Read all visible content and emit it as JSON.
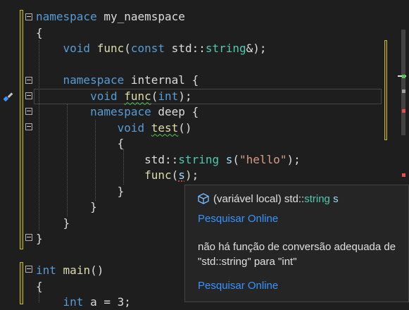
{
  "code_lines": [
    {
      "segments": [
        {
          "t": "namespace",
          "c": "kw"
        },
        {
          "t": " my_naemspace",
          "c": "ns"
        }
      ]
    },
    {
      "segments": [
        {
          "t": "{",
          "c": ""
        }
      ]
    },
    {
      "segments": [
        {
          "t": "    ",
          "c": ""
        },
        {
          "t": "void",
          "c": "kw"
        },
        {
          "t": " ",
          "c": ""
        },
        {
          "t": "func",
          "c": "fn"
        },
        {
          "t": "(",
          "c": ""
        },
        {
          "t": "const",
          "c": "kw"
        },
        {
          "t": " std::",
          "c": ""
        },
        {
          "t": "string",
          "c": "ty"
        },
        {
          "t": "&);",
          "c": ""
        }
      ]
    },
    {
      "segments": [
        {
          "t": "",
          "c": ""
        }
      ]
    },
    {
      "segments": [
        {
          "t": "    ",
          "c": ""
        },
        {
          "t": "namespace",
          "c": "kw"
        },
        {
          "t": " internal {",
          "c": "ns"
        }
      ]
    },
    {
      "segments": [
        {
          "t": "        ",
          "c": ""
        },
        {
          "t": "void",
          "c": "kw"
        },
        {
          "t": " ",
          "c": ""
        },
        {
          "t": "func",
          "c": "fn squig"
        },
        {
          "t": "(",
          "c": ""
        },
        {
          "t": "int",
          "c": "kw"
        },
        {
          "t": ");",
          "c": ""
        }
      ]
    },
    {
      "segments": [
        {
          "t": "        ",
          "c": ""
        },
        {
          "t": "namespace",
          "c": "kw"
        },
        {
          "t": " deep {",
          "c": "ns"
        }
      ]
    },
    {
      "segments": [
        {
          "t": "            ",
          "c": ""
        },
        {
          "t": "void",
          "c": "kw"
        },
        {
          "t": " ",
          "c": ""
        },
        {
          "t": "test",
          "c": "fn squig"
        },
        {
          "t": "()",
          "c": ""
        }
      ]
    },
    {
      "segments": [
        {
          "t": "            {",
          "c": ""
        }
      ]
    },
    {
      "segments": [
        {
          "t": "                std::",
          "c": ""
        },
        {
          "t": "string",
          "c": "ty"
        },
        {
          "t": " ",
          "c": ""
        },
        {
          "t": "s",
          "c": "var"
        },
        {
          "t": "(",
          "c": ""
        },
        {
          "t": "\"hello\"",
          "c": "str"
        },
        {
          "t": ");",
          "c": ""
        }
      ]
    },
    {
      "segments": [
        {
          "t": "                ",
          "c": ""
        },
        {
          "t": "func",
          "c": "fn"
        },
        {
          "t": "(",
          "c": ""
        },
        {
          "t": "s",
          "c": "var squig-red"
        },
        {
          "t": ");",
          "c": ""
        }
      ]
    },
    {
      "segments": [
        {
          "t": "            }",
          "c": ""
        }
      ]
    },
    {
      "segments": [
        {
          "t": "        }",
          "c": ""
        }
      ]
    },
    {
      "segments": [
        {
          "t": "    }",
          "c": ""
        }
      ]
    },
    {
      "segments": [
        {
          "t": "}",
          "c": ""
        }
      ]
    },
    {
      "segments": [
        {
          "t": "",
          "c": ""
        }
      ]
    },
    {
      "segments": [
        {
          "t": "int",
          "c": "kw"
        },
        {
          "t": " ",
          "c": ""
        },
        {
          "t": "main",
          "c": "fn"
        },
        {
          "t": "()",
          "c": ""
        }
      ]
    },
    {
      "segments": [
        {
          "t": "{",
          "c": ""
        }
      ]
    },
    {
      "segments": [
        {
          "t": "    ",
          "c": ""
        },
        {
          "t": "int",
          "c": "kw"
        },
        {
          "t": " a = 3;",
          "c": ""
        }
      ]
    }
  ],
  "tooltip": {
    "prefix": "(variável local) std::",
    "type": "string",
    "var": " s",
    "link1": "Pesquisar Online",
    "message": "não há função de conversão adequada de \"std::string\" para \"int\"",
    "link2": "Pesquisar Online"
  },
  "icons": [
    "fold-icon",
    "quick-action-screwdriver-icon",
    "variable-cube-icon"
  ],
  "colors": {
    "keyword": "#569cd6",
    "type": "#4ec9b0",
    "function": "#dcdcaa",
    "string": "#d69d85",
    "link": "#3794ff"
  }
}
